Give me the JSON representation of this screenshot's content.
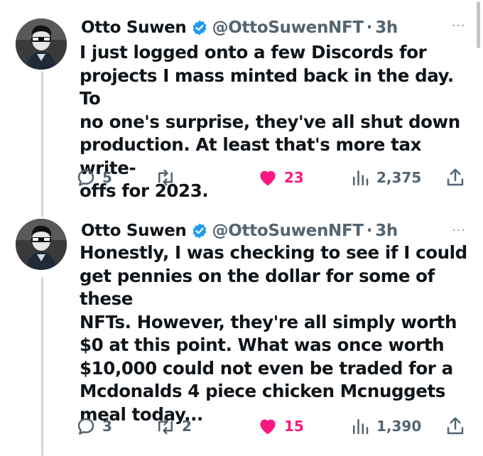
{
  "tweets": [
    {
      "display_name": "Otto Suwen",
      "handle": "@OttoSuwenNFT",
      "separator": "·",
      "time": "3h",
      "more": "···",
      "text": "I just logged onto a few Discords for\nprojects I mass minted back in the day. To\nno one's surprise, they've all shut down\nproduction. At least that's more tax write-\noffs for 2023.",
      "replies": "5",
      "retweets": "",
      "likes": "23",
      "views": "2,375",
      "liked": true
    },
    {
      "display_name": "Otto Suwen",
      "handle": "@OttoSuwenNFT",
      "separator": "·",
      "time": "3h",
      "more": "···",
      "text": "Honestly, I was checking to see if I could\nget pennies on the dollar for some of these\nNFTs. However, they're all simply worth\n$0 at this point. What was once worth\n$10,000 could not even be traded for a\nMcdonalds 4 piece chicken Mcnuggets\nmeal today...",
      "replies": "3",
      "retweets": "2",
      "likes": "15",
      "views": "1,390",
      "liked": true
    }
  ],
  "colors": {
    "verified": "#1d9bf0",
    "like": "#f91880",
    "icon_gray": "#536471",
    "thread_line": "#cfd9de"
  },
  "icons": [
    "verified-badge-icon",
    "reply-icon",
    "retweet-icon",
    "heart-icon",
    "views-icon",
    "share-icon",
    "more-icon"
  ]
}
